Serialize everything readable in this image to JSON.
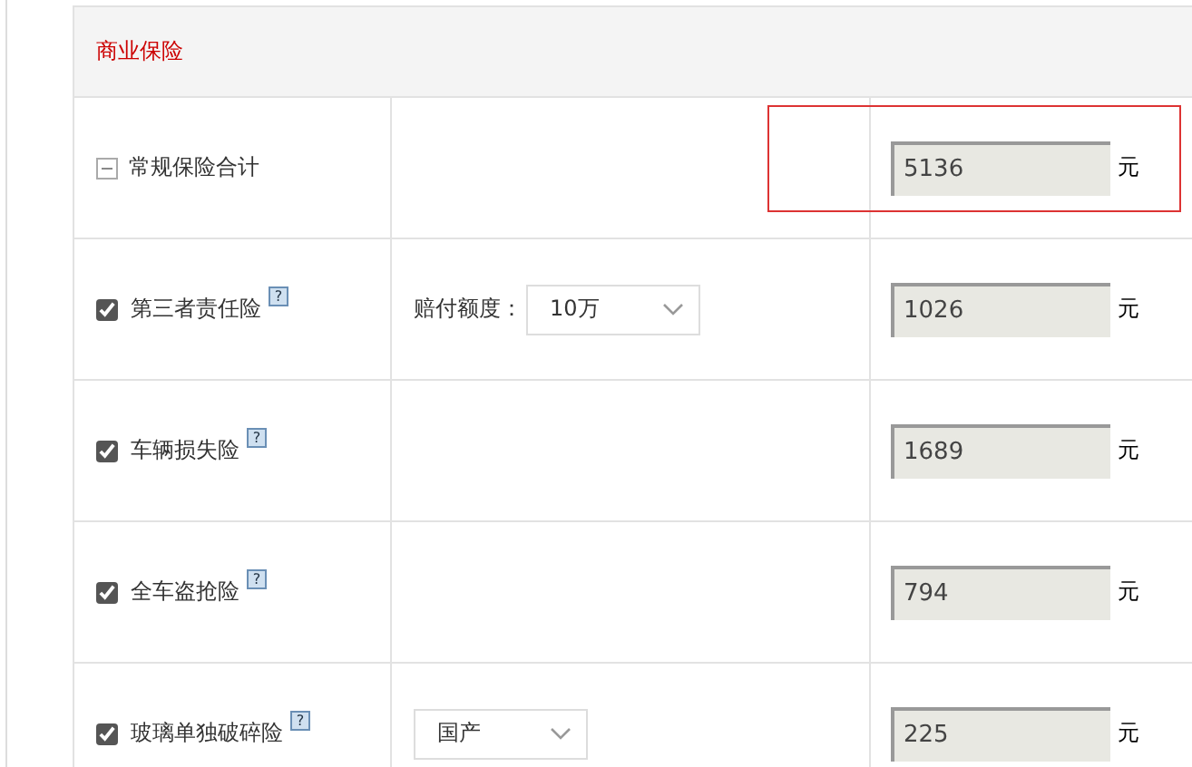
{
  "section_title": "商业保险",
  "rows": [
    {
      "kind": "total",
      "name": "常规保险合计",
      "expanded": true,
      "highlighted": true,
      "amount": "5136",
      "unit": "元"
    },
    {
      "kind": "item",
      "name": "第三者责任险",
      "checked": true,
      "help": "?",
      "option": {
        "label": "赔付额度：",
        "value": "10万"
      },
      "amount": "1026",
      "unit": "元"
    },
    {
      "kind": "item",
      "name": "车辆损失险",
      "checked": true,
      "help": "?",
      "amount": "1689",
      "unit": "元"
    },
    {
      "kind": "item",
      "name": "全车盗抢险",
      "checked": true,
      "help": "?",
      "amount": "794",
      "unit": "元"
    },
    {
      "kind": "item",
      "name": "玻璃单独破碎险",
      "checked": true,
      "help": "?",
      "option": {
        "value": "国产"
      },
      "amount": "225",
      "unit": "元"
    }
  ]
}
